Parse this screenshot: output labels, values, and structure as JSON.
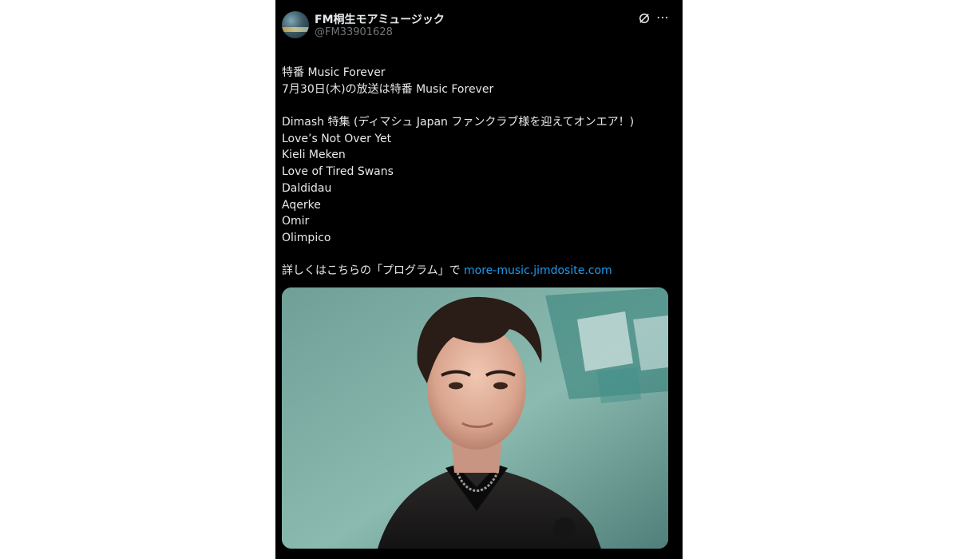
{
  "author": {
    "display_name": "FM桐生モアミュージック",
    "handle": "@FM33901628"
  },
  "header": {
    "icon": "grok-icon",
    "more_icon": "more-icon"
  },
  "post": {
    "lines": [
      "特番 Music Forever",
      "7月30日(木)の放送は特番 Music Forever",
      "",
      "Dimash 特集 (ディマシュ Japan ファンクラブ様を迎えてオンエア！)",
      "Love’s Not Over Yet",
      "Kieli Meken",
      "Love of Tired Swans",
      "Daldidau",
      "Aqerke",
      "Omir",
      "Olimpico",
      ""
    ],
    "closing_text": "詳しくはこちらの「プログラム」で ",
    "link_text": "more-music.jimdosite.com"
  },
  "colors": {
    "background": "#000000",
    "text": "#e7e9ea",
    "secondary": "#71767b",
    "link": "#1d9bf0"
  }
}
